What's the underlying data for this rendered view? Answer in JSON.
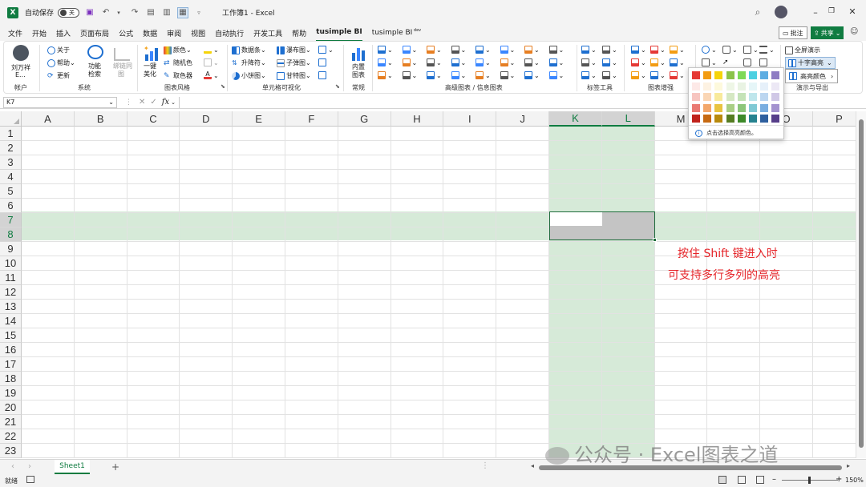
{
  "titlebar": {
    "autosave_label": "自动保存",
    "autosave_state": "关",
    "doc_title": "工作簿1 - Excel"
  },
  "tabs": [
    "文件",
    "开始",
    "插入",
    "页面布局",
    "公式",
    "数据",
    "审阅",
    "视图",
    "自动执行",
    "开发工具",
    "帮助",
    "tusimple BI",
    "tusimple BI"
  ],
  "tab_dev_suffix": "dev",
  "active_tab": "tusimple BI",
  "right_buttons": {
    "comment": "批注",
    "share": "共享"
  },
  "ribbon": {
    "account": {
      "user": "刘万祥",
      "user_line2": "E...",
      "group": "帐户"
    },
    "system": {
      "about": "关于",
      "help": "帮助",
      "update": "更新",
      "search_line1": "功能",
      "search_line2": "检索",
      "draw_line1": "绑链同",
      "draw_line2": "图",
      "group": "系统"
    },
    "chart_style": {
      "beautify_line1": "一键",
      "beautify_line2": "美化",
      "color": "颜色",
      "random": "随机色",
      "picker": "取色器",
      "group": "图表风格"
    },
    "cell_viz": {
      "databar": "数据条",
      "waterfall": "瀑布图",
      "updown": "升降符",
      "bullet": "子弹图",
      "pie": "小饼图",
      "gantt": "甘特图",
      "group": "单元格可视化"
    },
    "normal": {
      "inner_line1": "内置",
      "inner_line2": "图表",
      "group": "常规"
    },
    "advanced_group": "高级图表 / 信息图表",
    "label_group": "标签工具",
    "enhance_group": "图表增强",
    "present": {
      "fullscreen": "全屏演示",
      "crosshair": "十字高亮",
      "group": "演示与导出"
    }
  },
  "popup": {
    "hint": "点击选择高亮颜色。",
    "submenu": "高亮颜色",
    "colors": [
      [
        "#e53935",
        "#f39c12",
        "#f5d40a",
        "#8bc34a",
        "#7ed957",
        "#4dd0e1",
        "#5dade2",
        "#8e7cc3"
      ],
      [
        "#fde9e7",
        "#fdf2e2",
        "#fdf9dc",
        "#eef6e6",
        "#e9f3e3",
        "#e6f6f8",
        "#e6f0fa",
        "#ece8f5"
      ],
      [
        "#f7c5c0",
        "#fad6b5",
        "#f8ea9c",
        "#d5e8c3",
        "#c5e3b8",
        "#bfe6ec",
        "#bcd6f0",
        "#d0c8e6"
      ],
      [
        "#ea7a73",
        "#f3a76b",
        "#e9c440",
        "#a9cf85",
        "#8cc67a",
        "#80c9d4",
        "#7aaee0",
        "#a493cf"
      ],
      [
        "#c0221b",
        "#c76a12",
        "#b88a0c",
        "#557d22",
        "#3d8a2a",
        "#26828f",
        "#2e5f9e",
        "#563e8a"
      ]
    ]
  },
  "formula_bar": {
    "name_box": "K7",
    "fx": "fx",
    "value": ""
  },
  "columns": [
    "A",
    "B",
    "C",
    "D",
    "E",
    "F",
    "G",
    "H",
    "I",
    "J",
    "K",
    "L",
    "M",
    "N",
    "O",
    "P"
  ],
  "rows": [
    "1",
    "2",
    "3",
    "4",
    "5",
    "6",
    "7",
    "8",
    "9",
    "10",
    "11",
    "12",
    "13",
    "14",
    "15",
    "16",
    "17",
    "18",
    "19",
    "20",
    "21",
    "22",
    "23"
  ],
  "selection": {
    "columns": [
      "K",
      "L"
    ],
    "rows": [
      "7",
      "8"
    ],
    "active_cell": "K7"
  },
  "highlight_color": "#d6ead8",
  "annotation": {
    "line1": "按住 Shift 键进入时",
    "line2": "可支持多行多列的高亮"
  },
  "sheet_tabs": [
    "Sheet1"
  ],
  "statusbar": {
    "ready": "就绪",
    "zoom": "150%"
  },
  "watermark": "公众号 · Excel图表之道"
}
